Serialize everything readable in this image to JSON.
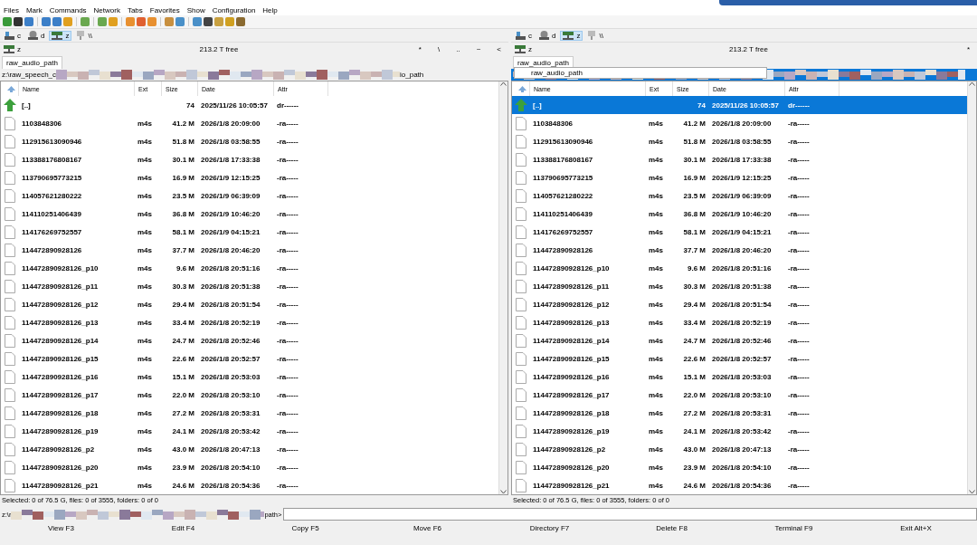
{
  "menu": [
    "Files",
    "Mark",
    "Commands",
    "Network",
    "Tabs",
    "Favorites",
    "Show",
    "Configuration",
    "Help"
  ],
  "panels": [
    {
      "active": false,
      "drives": [
        {
          "label": "c",
          "kind": "disk",
          "selected": false
        },
        {
          "label": "d",
          "kind": "optical",
          "selected": false
        },
        {
          "label": "z",
          "kind": "network",
          "selected": true
        },
        {
          "label": "\\\\",
          "kind": "share",
          "selected": false
        }
      ],
      "drive": "z",
      "free": "213.2 T free",
      "nav_buttons": [
        "*",
        "\\",
        "..",
        "~",
        "<"
      ],
      "tabs": [
        {
          "label": "raw_audio_path",
          "selected": true
        }
      ],
      "path_start": "z:\\raw_speech_c",
      "path_end": "io_path",
      "columns": [
        "Name",
        "Ext",
        "Size",
        "Date",
        "Attr"
      ],
      "rows": [
        {
          "kind": "parent",
          "name": "[..]",
          "ext": "",
          "size": "74",
          "date": "2025/11/26 10:05:57",
          "attr": "dr------",
          "selected": false
        },
        {
          "kind": "file",
          "name": "1103848306",
          "ext": "m4s",
          "size": "41.2 M",
          "date": "2026/1/8 20:09:00",
          "attr": "-ra-----",
          "selected": false
        },
        {
          "kind": "file",
          "name": "112915613090946",
          "ext": "m4s",
          "size": "51.8 M",
          "date": "2026/1/8 03:58:55",
          "attr": "-ra-----",
          "selected": false
        },
        {
          "kind": "file",
          "name": "113388176808167",
          "ext": "m4s",
          "size": "30.1 M",
          "date": "2026/1/8 17:33:38",
          "attr": "-ra-----",
          "selected": false
        },
        {
          "kind": "file",
          "name": "113790695773215",
          "ext": "m4s",
          "size": "16.9 M",
          "date": "2026/1/9 12:15:25",
          "attr": "-ra-----",
          "selected": false
        },
        {
          "kind": "file",
          "name": "114057621280222",
          "ext": "m4s",
          "size": "23.5 M",
          "date": "2026/1/9 06:39:09",
          "attr": "-ra-----",
          "selected": false
        },
        {
          "kind": "file",
          "name": "114110251406439",
          "ext": "m4s",
          "size": "36.8 M",
          "date": "2026/1/9 10:46:20",
          "attr": "-ra-----",
          "selected": false
        },
        {
          "kind": "file",
          "name": "114176269752557",
          "ext": "m4s",
          "size": "58.1 M",
          "date": "2026/1/9 04:15:21",
          "attr": "-ra-----",
          "selected": false
        },
        {
          "kind": "file",
          "name": "114472890928126",
          "ext": "m4s",
          "size": "37.7 M",
          "date": "2026/1/8 20:46:20",
          "attr": "-ra-----",
          "selected": false
        },
        {
          "kind": "file",
          "name": "114472890928126_p10",
          "ext": "m4s",
          "size": "9.6 M",
          "date": "2026/1/8 20:51:16",
          "attr": "-ra-----",
          "selected": false
        },
        {
          "kind": "file",
          "name": "114472890928126_p11",
          "ext": "m4s",
          "size": "30.3 M",
          "date": "2026/1/8 20:51:38",
          "attr": "-ra-----",
          "selected": false
        },
        {
          "kind": "file",
          "name": "114472890928126_p12",
          "ext": "m4s",
          "size": "29.4 M",
          "date": "2026/1/8 20:51:54",
          "attr": "-ra-----",
          "selected": false
        },
        {
          "kind": "file",
          "name": "114472890928126_p13",
          "ext": "m4s",
          "size": "33.4 M",
          "date": "2026/1/8 20:52:19",
          "attr": "-ra-----",
          "selected": false
        },
        {
          "kind": "file",
          "name": "114472890928126_p14",
          "ext": "m4s",
          "size": "24.7 M",
          "date": "2026/1/8 20:52:46",
          "attr": "-ra-----",
          "selected": false
        },
        {
          "kind": "file",
          "name": "114472890928126_p15",
          "ext": "m4s",
          "size": "22.6 M",
          "date": "2026/1/8 20:52:57",
          "attr": "-ra-----",
          "selected": false
        },
        {
          "kind": "file",
          "name": "114472890928126_p16",
          "ext": "m4s",
          "size": "15.1 M",
          "date": "2026/1/8 20:53:03",
          "attr": "-ra-----",
          "selected": false
        },
        {
          "kind": "file",
          "name": "114472890928126_p17",
          "ext": "m4s",
          "size": "22.0 M",
          "date": "2026/1/8 20:53:10",
          "attr": "-ra-----",
          "selected": false
        },
        {
          "kind": "file",
          "name": "114472890928126_p18",
          "ext": "m4s",
          "size": "27.2 M",
          "date": "2026/1/8 20:53:31",
          "attr": "-ra-----",
          "selected": false
        },
        {
          "kind": "file",
          "name": "114472890928126_p19",
          "ext": "m4s",
          "size": "24.1 M",
          "date": "2026/1/8 20:53:42",
          "attr": "-ra-----",
          "selected": false
        },
        {
          "kind": "file",
          "name": "114472890928126_p2",
          "ext": "m4s",
          "size": "43.0 M",
          "date": "2026/1/8 20:47:13",
          "attr": "-ra-----",
          "selected": false
        },
        {
          "kind": "file",
          "name": "114472890928126_p20",
          "ext": "m4s",
          "size": "23.9 M",
          "date": "2026/1/8 20:54:10",
          "attr": "-ra-----",
          "selected": false
        },
        {
          "kind": "file",
          "name": "114472890928126_p21",
          "ext": "m4s",
          "size": "24.6 M",
          "date": "2026/1/8 20:54:36",
          "attr": "-ra-----",
          "selected": false
        }
      ],
      "status": "Selected: 0 of 76.5 G, files: 0 of 3555, folders: 0 of 0"
    },
    {
      "active": true,
      "drives": [
        {
          "label": "c",
          "kind": "disk",
          "selected": false
        },
        {
          "label": "d",
          "kind": "optical",
          "selected": false
        },
        {
          "label": "z",
          "kind": "network",
          "selected": true
        },
        {
          "label": "\\\\",
          "kind": "share",
          "selected": false
        }
      ],
      "drive": "z",
      "free": "213.2 T free",
      "nav_buttons": [
        "*"
      ],
      "tabs": [
        {
          "label": "raw_audio_path",
          "selected": true
        }
      ],
      "tab_menu": "raw_audio_path",
      "columns": [
        "Name",
        "Ext",
        "Size",
        "Date",
        "Attr"
      ],
      "rows": [
        {
          "kind": "parent",
          "name": "[..]",
          "ext": "",
          "size": "74",
          "date": "2025/11/26 10:05:57",
          "attr": "dr------",
          "selected": true
        },
        {
          "kind": "file",
          "name": "1103848306",
          "ext": "m4s",
          "size": "41.2 M",
          "date": "2026/1/8 20:09:00",
          "attr": "-ra-----",
          "selected": false
        },
        {
          "kind": "file",
          "name": "112915613090946",
          "ext": "m4s",
          "size": "51.8 M",
          "date": "2026/1/8 03:58:55",
          "attr": "-ra-----",
          "selected": false
        },
        {
          "kind": "file",
          "name": "113388176808167",
          "ext": "m4s",
          "size": "30.1 M",
          "date": "2026/1/8 17:33:38",
          "attr": "-ra-----",
          "selected": false
        },
        {
          "kind": "file",
          "name": "113790695773215",
          "ext": "m4s",
          "size": "16.9 M",
          "date": "2026/1/9 12:15:25",
          "attr": "-ra-----",
          "selected": false
        },
        {
          "kind": "file",
          "name": "114057621280222",
          "ext": "m4s",
          "size": "23.5 M",
          "date": "2026/1/9 06:39:09",
          "attr": "-ra-----",
          "selected": false
        },
        {
          "kind": "file",
          "name": "114110251406439",
          "ext": "m4s",
          "size": "36.8 M",
          "date": "2026/1/9 10:46:20",
          "attr": "-ra-----",
          "selected": false
        },
        {
          "kind": "file",
          "name": "114176269752557",
          "ext": "m4s",
          "size": "58.1 M",
          "date": "2026/1/9 04:15:21",
          "attr": "-ra-----",
          "selected": false
        },
        {
          "kind": "file",
          "name": "114472890928126",
          "ext": "m4s",
          "size": "37.7 M",
          "date": "2026/1/8 20:46:20",
          "attr": "-ra-----",
          "selected": false
        },
        {
          "kind": "file",
          "name": "114472890928126_p10",
          "ext": "m4s",
          "size": "9.6 M",
          "date": "2026/1/8 20:51:16",
          "attr": "-ra-----",
          "selected": false
        },
        {
          "kind": "file",
          "name": "114472890928126_p11",
          "ext": "m4s",
          "size": "30.3 M",
          "date": "2026/1/8 20:51:38",
          "attr": "-ra-----",
          "selected": false
        },
        {
          "kind": "file",
          "name": "114472890928126_p12",
          "ext": "m4s",
          "size": "29.4 M",
          "date": "2026/1/8 20:51:54",
          "attr": "-ra-----",
          "selected": false
        },
        {
          "kind": "file",
          "name": "114472890928126_p13",
          "ext": "m4s",
          "size": "33.4 M",
          "date": "2026/1/8 20:52:19",
          "attr": "-ra-----",
          "selected": false
        },
        {
          "kind": "file",
          "name": "114472890928126_p14",
          "ext": "m4s",
          "size": "24.7 M",
          "date": "2026/1/8 20:52:46",
          "attr": "-ra-----",
          "selected": false
        },
        {
          "kind": "file",
          "name": "114472890928126_p15",
          "ext": "m4s",
          "size": "22.6 M",
          "date": "2026/1/8 20:52:57",
          "attr": "-ra-----",
          "selected": false
        },
        {
          "kind": "file",
          "name": "114472890928126_p16",
          "ext": "m4s",
          "size": "15.1 M",
          "date": "2026/1/8 20:53:03",
          "attr": "-ra-----",
          "selected": false
        },
        {
          "kind": "file",
          "name": "114472890928126_p17",
          "ext": "m4s",
          "size": "22.0 M",
          "date": "2026/1/8 20:53:10",
          "attr": "-ra-----",
          "selected": false
        },
        {
          "kind": "file",
          "name": "114472890928126_p18",
          "ext": "m4s",
          "size": "27.2 M",
          "date": "2026/1/8 20:53:31",
          "attr": "-ra-----",
          "selected": false
        },
        {
          "kind": "file",
          "name": "114472890928126_p19",
          "ext": "m4s",
          "size": "24.1 M",
          "date": "2026/1/8 20:53:42",
          "attr": "-ra-----",
          "selected": false
        },
        {
          "kind": "file",
          "name": "114472890928126_p2",
          "ext": "m4s",
          "size": "43.0 M",
          "date": "2026/1/8 20:47:13",
          "attr": "-ra-----",
          "selected": false
        },
        {
          "kind": "file",
          "name": "114472890928126_p20",
          "ext": "m4s",
          "size": "23.9 M",
          "date": "2026/1/8 20:54:10",
          "attr": "-ra-----",
          "selected": false
        },
        {
          "kind": "file",
          "name": "114472890928126_p21",
          "ext": "m4s",
          "size": "24.6 M",
          "date": "2026/1/8 20:54:36",
          "attr": "-ra-----",
          "selected": false
        }
      ],
      "status": "Selected: 0 of 76.5 G, files: 0 of 3555, folders: 0 of 0"
    }
  ],
  "command_line": {
    "prompt_start": "z:\\r",
    "prompt_end": "path>"
  },
  "function_keys": [
    "View F3",
    "Edit F4",
    "Copy F5",
    "Move F6",
    "Directory F7",
    "Delete F8",
    "Terminal F9",
    "Exit Alt+X"
  ]
}
